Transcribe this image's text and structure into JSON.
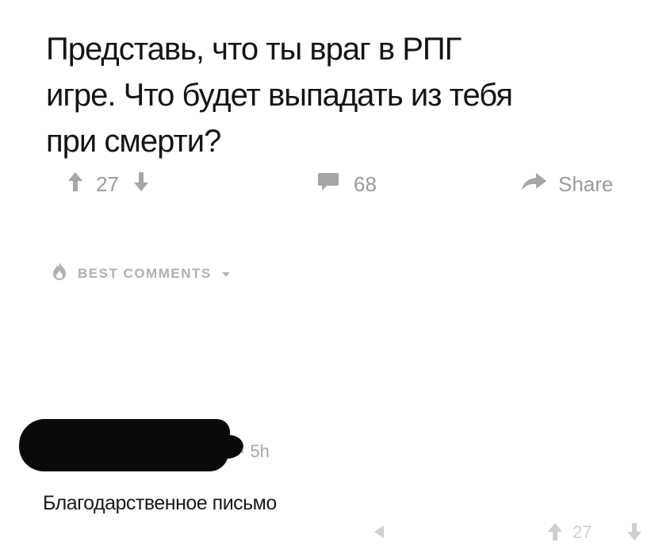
{
  "post": {
    "title_lines": [
      "Представь, что ты враг в РПГ",
      "игре. Что будет выпадать из тебя",
      "при смерти?"
    ],
    "upvotes": "27",
    "comments_count": "68",
    "share_label": "Share"
  },
  "comments_section": {
    "sort_label": "BEST COMMENTS"
  },
  "comment": {
    "meta": "· 5h",
    "text": "Благодарственное письмо"
  },
  "comment_actions": {
    "upvotes": "27"
  },
  "colors": {
    "muted_icon": "#a6a6a6",
    "title_text": "#151515",
    "redaction": "#0a0a0a"
  },
  "icons": [
    "arrow-up-icon",
    "arrow-down-icon",
    "comment-bubble-icon",
    "share-arrow-icon",
    "flame-icon",
    "chevron-down-icon"
  ]
}
